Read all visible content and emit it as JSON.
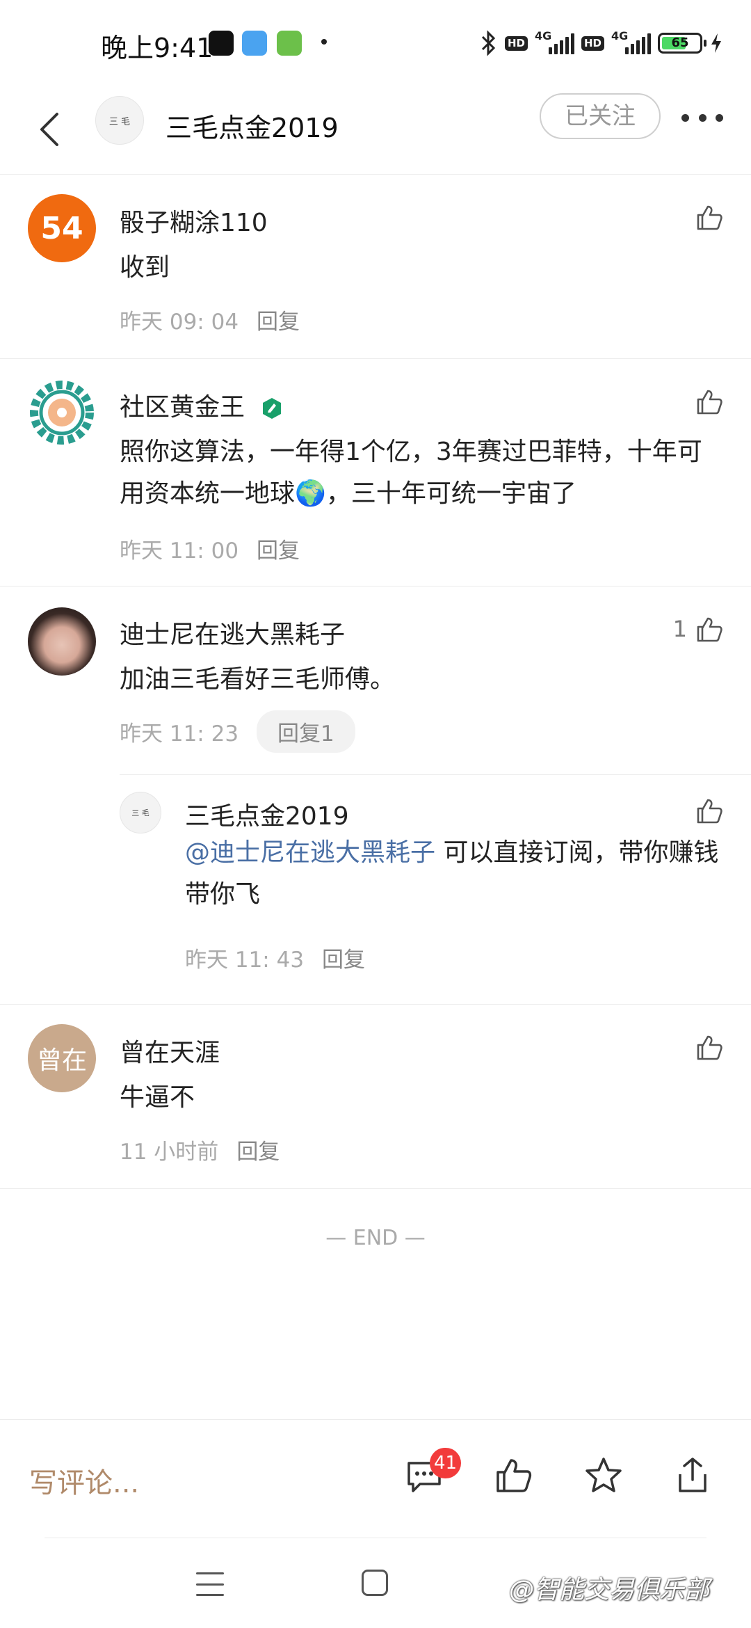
{
  "status_bar": {
    "time": "晚上9:41",
    "network_1": "4G",
    "network_2": "4G",
    "hd_label": "HD",
    "battery": "65"
  },
  "header": {
    "title": "三毛点金2019",
    "follow_label": "已关注",
    "avatar_text": "三 毛"
  },
  "comments": [
    {
      "avatar_text": "54",
      "name": "骰子糊涂110",
      "body": "收到",
      "time": "昨天 09: 04",
      "reply_label": "回复"
    },
    {
      "name": "社区黄金王",
      "body": "照你这算法，一年得1个亿，3年赛过巴菲特，十年可用资本统一地球🌍，三十年可统一宇宙了",
      "time": "昨天 11: 00",
      "reply_label": "回复"
    },
    {
      "name": "迪士尼在逃大黑耗子",
      "body": "加油三毛看好三毛师傅。",
      "time": "昨天 11: 23",
      "reply_label": "回复1",
      "like_count": "1",
      "reply": {
        "avatar_text": "三 毛",
        "name": "三毛点金2019",
        "mention": "@迪士尼在逃大黑耗子",
        "body": " 可以直接订阅，带你赚钱带你飞",
        "time": "昨天 11: 43",
        "reply_label": "回复"
      }
    },
    {
      "avatar_text": "曾在",
      "name": "曾在天涯",
      "body": "牛逼不",
      "time": "11 小时前",
      "reply_label": "回复"
    }
  ],
  "end_label": "— END —",
  "bottom_bar": {
    "write_placeholder": "写评论...",
    "comment_count": "41"
  },
  "watermark": "@智能交易俱乐部",
  "colors": {
    "accent_orange": "#f06a10",
    "mention_blue": "#4a6fa5",
    "badge_red": "#f23b3b",
    "write_brown": "#b08a6a"
  },
  "icons": [
    "back-arrow-icon",
    "more-dots-icon",
    "thumbs-up-icon",
    "verified-badge-icon",
    "comment-icon",
    "star-icon",
    "share-icon",
    "bluetooth-icon"
  ]
}
